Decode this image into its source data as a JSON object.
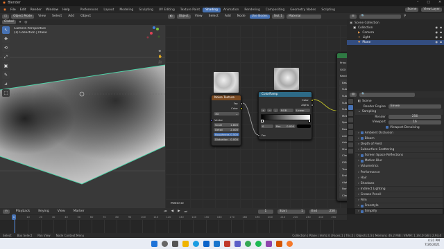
{
  "window": {
    "title": "Blender",
    "min": "–",
    "max": "□",
    "close": "✕"
  },
  "menus": [
    "File",
    "Edit",
    "Render",
    "Window",
    "Help"
  ],
  "workspaces": [
    "Preferences",
    "Layout",
    "Modeling",
    "Sculpting",
    "UV Editing",
    "Texture Paint",
    "Shading",
    "Animation",
    "Rendering",
    "Compositing",
    "Geometry Nodes",
    "Scripting"
  ],
  "active_workspace": "Shading",
  "topbar_left": {
    "layout_label": "Layout",
    "tab_label": "Shading",
    "global": "Global"
  },
  "viewport": {
    "mode": "Object Mode",
    "menus": [
      "View",
      "Select",
      "Add",
      "Object"
    ],
    "orientation": "Global",
    "camera_label": "Camera Perspective",
    "collection_label": "(1) Collection | Plane",
    "tools": [
      "↖",
      "✥",
      "⟲",
      "⤢",
      "▣",
      "✎",
      "⊿",
      "⬚"
    ]
  },
  "node_editor": {
    "editor": "Object",
    "menus": [
      "View",
      "Select",
      "Add",
      "Node"
    ],
    "use_nodes": "Use Nodes",
    "slot": "Slot 1",
    "material": "Material",
    "footer": "Material",
    "noise_node": {
      "title": "Noise Texture",
      "outputs": [
        "Fac",
        "Color"
      ],
      "dim": "3D",
      "vector": "Vector",
      "fields": [
        {
          "label": "Scale",
          "value": "1.800"
        },
        {
          "label": "Detail",
          "value": "2.000"
        },
        {
          "label": "Roughness",
          "value": "0.500"
        },
        {
          "label": "Distortion",
          "value": "0.000"
        }
      ]
    },
    "ramp_node": {
      "title": "ColorRamp",
      "outputs": [
        "Color",
        "Alpha"
      ],
      "mode": "RGB",
      "interp": "Linear",
      "index": "0",
      "pos_label": "Pos",
      "pos_value": "0.000",
      "input": "Fac"
    },
    "bsdf_partial": [
      "Princ",
      "GGX",
      "Rand",
      "Base",
      "Subsu",
      "Subsu",
      "Subsu",
      "Subsu",
      "Metal",
      "Spec",
      "Rough",
      "Aniso",
      "Aniso",
      "Sheen",
      "Clea",
      "IOR",
      "Trans",
      "Emiss",
      "Alpha",
      "Norma",
      "Clear"
    ]
  },
  "outliner": {
    "title": "Scene",
    "view_layer": "View Layer",
    "items": [
      {
        "label": "Scene Collection",
        "indent": 0
      },
      {
        "label": "Collection",
        "indent": 1
      },
      {
        "label": "Camera",
        "indent": 2
      },
      {
        "label": "Light",
        "indent": 2
      },
      {
        "label": "Plane",
        "indent": 2
      }
    ],
    "selected_index": 4
  },
  "properties": {
    "scene": "Scene",
    "render_engine_label": "Render Engine",
    "render_engine": "Eevee",
    "sampling": "Sampling",
    "render_label": "Render",
    "render_val": "256",
    "viewport_label": "Viewport",
    "viewport_val": "16",
    "viewport_denoising": "Viewport Denoising",
    "sections": [
      {
        "label": "Ambient Occlusion",
        "check": true
      },
      {
        "label": "Bloom",
        "check": true
      },
      {
        "label": "Depth of Field",
        "check": false
      },
      {
        "label": "Subsurface Scattering",
        "check": false
      },
      {
        "label": "Screen Space Reflections",
        "check": true
      },
      {
        "label": "Motion Blur",
        "check": true
      },
      {
        "label": "Volumetrics",
        "check": false
      },
      {
        "label": "Performance",
        "check": false
      },
      {
        "label": "Hair",
        "check": false
      },
      {
        "label": "Shadows",
        "check": false
      },
      {
        "label": "Indirect Lighting",
        "check": false
      },
      {
        "label": "Grease Pencil",
        "check": false
      },
      {
        "label": "Film",
        "check": false
      },
      {
        "label": "Freestyle",
        "check": true
      },
      {
        "label": "Simplify",
        "check": true
      },
      {
        "label": "Colormanagement",
        "check": false
      }
    ]
  },
  "timeline": {
    "menus": [
      "Playback",
      "Keying",
      "View",
      "Marker"
    ],
    "current": "1",
    "start_label": "Start",
    "start": "1",
    "end_label": "End",
    "end": "250",
    "ticks": [
      "0",
      "10",
      "20",
      "30",
      "40",
      "50",
      "60",
      "70",
      "80",
      "90",
      "100",
      "110",
      "120",
      "130",
      "140",
      "150",
      "160",
      "170",
      "180",
      "190",
      "200",
      "210",
      "220",
      "230",
      "240",
      "250"
    ]
  },
  "status": {
    "select": "Select",
    "box_select": "Box Select",
    "pan": "Pan View",
    "context": "Node Context Menu",
    "stats": "Collection | Plane | Verts:4 | Faces:1 | Tris:2 | Objects:1/3 | Memory: 46.2 MiB | VRAM: 1.3/4.0 GiB | 2.93.4"
  },
  "clock": {
    "time": "4:31 PM",
    "date": "7/26/2021"
  }
}
